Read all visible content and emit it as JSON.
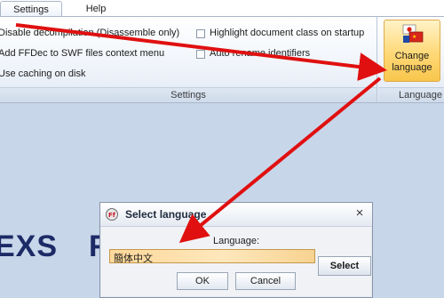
{
  "tabs": {
    "settings": "Settings",
    "help": "Help"
  },
  "ribbon": {
    "settings_options": {
      "disable_decompilation": "Disable decompilation (Disassemble only)",
      "add_context_menu": "Add FFDec to SWF files context menu",
      "use_caching": "Use caching on disk",
      "highlight_class": "Highlight document class on startup",
      "auto_rename": "Auto rename identifiers"
    },
    "settings_group_label": "Settings",
    "language_group_label": "Language",
    "change_language_line1": "Change",
    "change_language_line2": "language"
  },
  "workspace": {
    "text_left": "EXS",
    "text_right": "F"
  },
  "dialog": {
    "title": "Select language",
    "close": "×",
    "language_label": "Language:",
    "selected_language": "簡体中文",
    "select_button": "Select",
    "ok": "OK",
    "cancel": "Cancel"
  },
  "colors": {
    "arrow": "#e01010",
    "accent": "#ffd877"
  }
}
